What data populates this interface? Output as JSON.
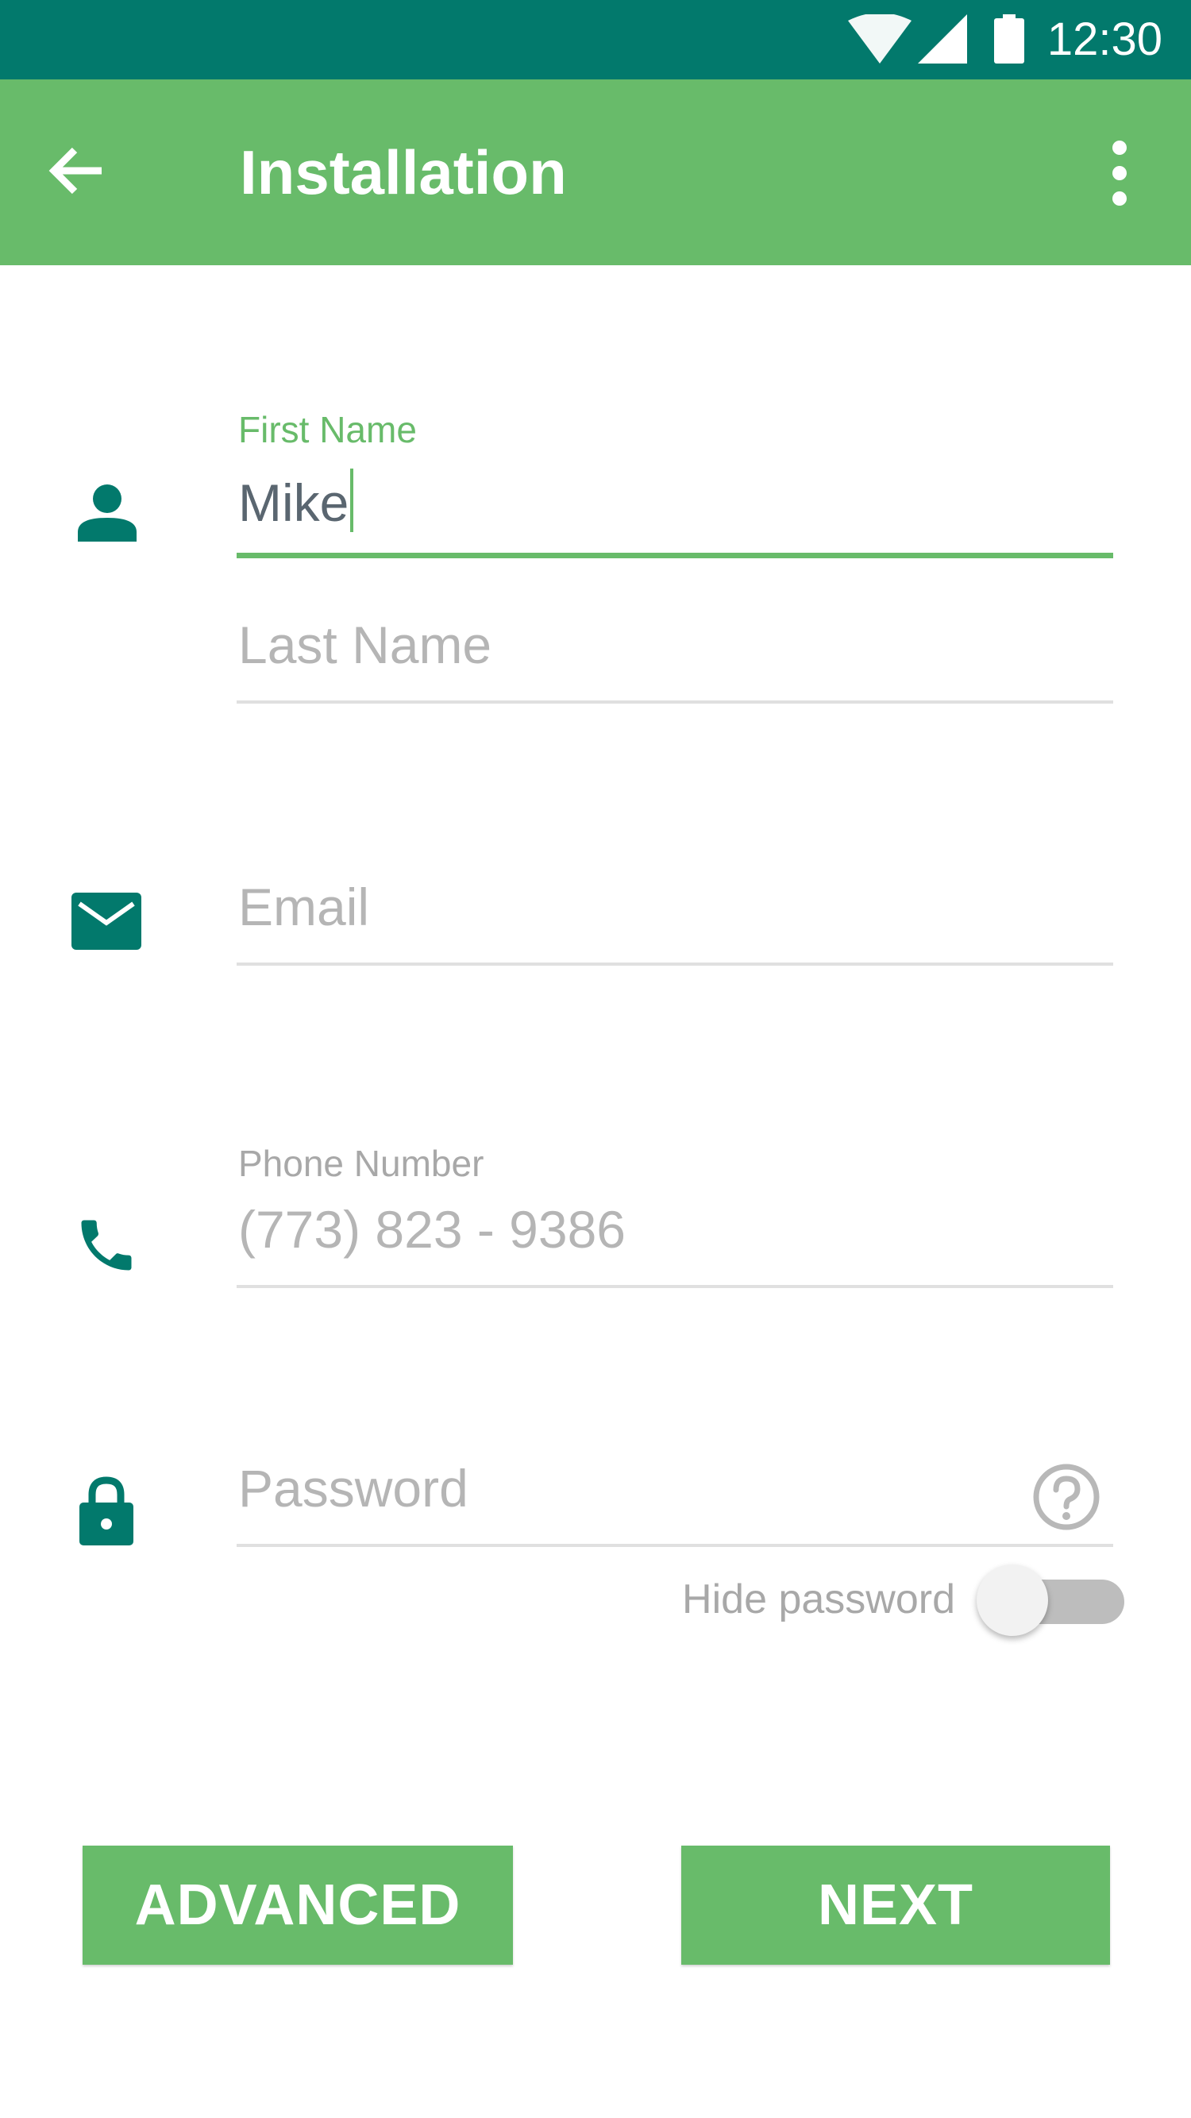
{
  "status_bar": {
    "time": "12:30",
    "icons": [
      "wifi-icon",
      "signal-icon",
      "battery-icon"
    ],
    "color": "#02796C"
  },
  "app_bar": {
    "title": "Installation",
    "back_icon": "arrow-back-icon",
    "menu_icon": "more-vert-icon",
    "color": "#68BB6A"
  },
  "form": {
    "first_name": {
      "label": "First Name",
      "value": "Mike",
      "icon": "person-icon"
    },
    "last_name": {
      "placeholder": "Last Name"
    },
    "email": {
      "placeholder": "Email",
      "icon": "email-icon"
    },
    "phone": {
      "label": "Phone Number",
      "placeholder": "(773) 823 - 9386",
      "icon": "phone-icon"
    },
    "password": {
      "placeholder": "Password",
      "icon": "lock-icon",
      "help_icon": "help-circle-icon"
    },
    "hide_password": {
      "label": "Hide password",
      "on": false
    }
  },
  "buttons": {
    "advanced": "ADVANCED",
    "next": "NEXT"
  },
  "colors": {
    "accent": "#68BB6A",
    "icon_teal": "#02796C",
    "placeholder": "#B5B5B5",
    "divider": "#E0E0E0"
  }
}
